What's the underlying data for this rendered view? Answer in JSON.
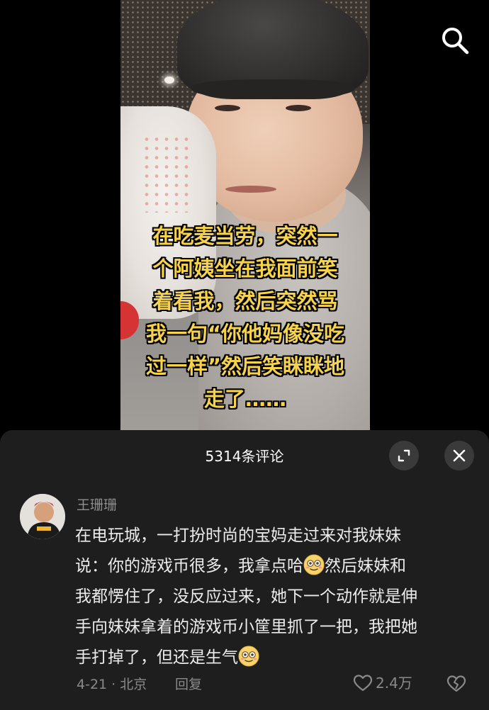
{
  "video": {
    "subtitle_lines": [
      "在吃麦当劳，突然一",
      "个阿姨坐在我面前笑",
      "着看我，然后突然骂",
      "我一句“你他妈像没吃",
      "过一样”然后笑眯眯地",
      "走了……"
    ],
    "search_icon": "search-icon"
  },
  "comments_panel": {
    "title": "5314条评论",
    "expand_icon": "expand-icon",
    "close_icon": "close-icon",
    "comment": {
      "username": "王珊珊",
      "lines": [
        "在电玩城，一打扮时尚的宝妈走过来对我妹妹",
        "说：你的游戏币很多，我拿点哈",
        "然后妹妹和",
        "我都愣住了，没反应过来，她下一个动作就是伸",
        "手向妹妹拿着的游戏币小筐里抓了一把，我把她",
        "手打掉了，但还是生气"
      ],
      "emoji": "smiling-face-emoji",
      "meta": "4-21 · 北京",
      "reply_label": "回复",
      "likes": "2.4万",
      "like_icon": "heart-icon",
      "dislike_icon": "broken-heart-icon"
    }
  },
  "colors": {
    "subtitle": "#f6d34a",
    "panel_bg": "#1e1e1e",
    "muted_text": "#8a8a8a"
  }
}
